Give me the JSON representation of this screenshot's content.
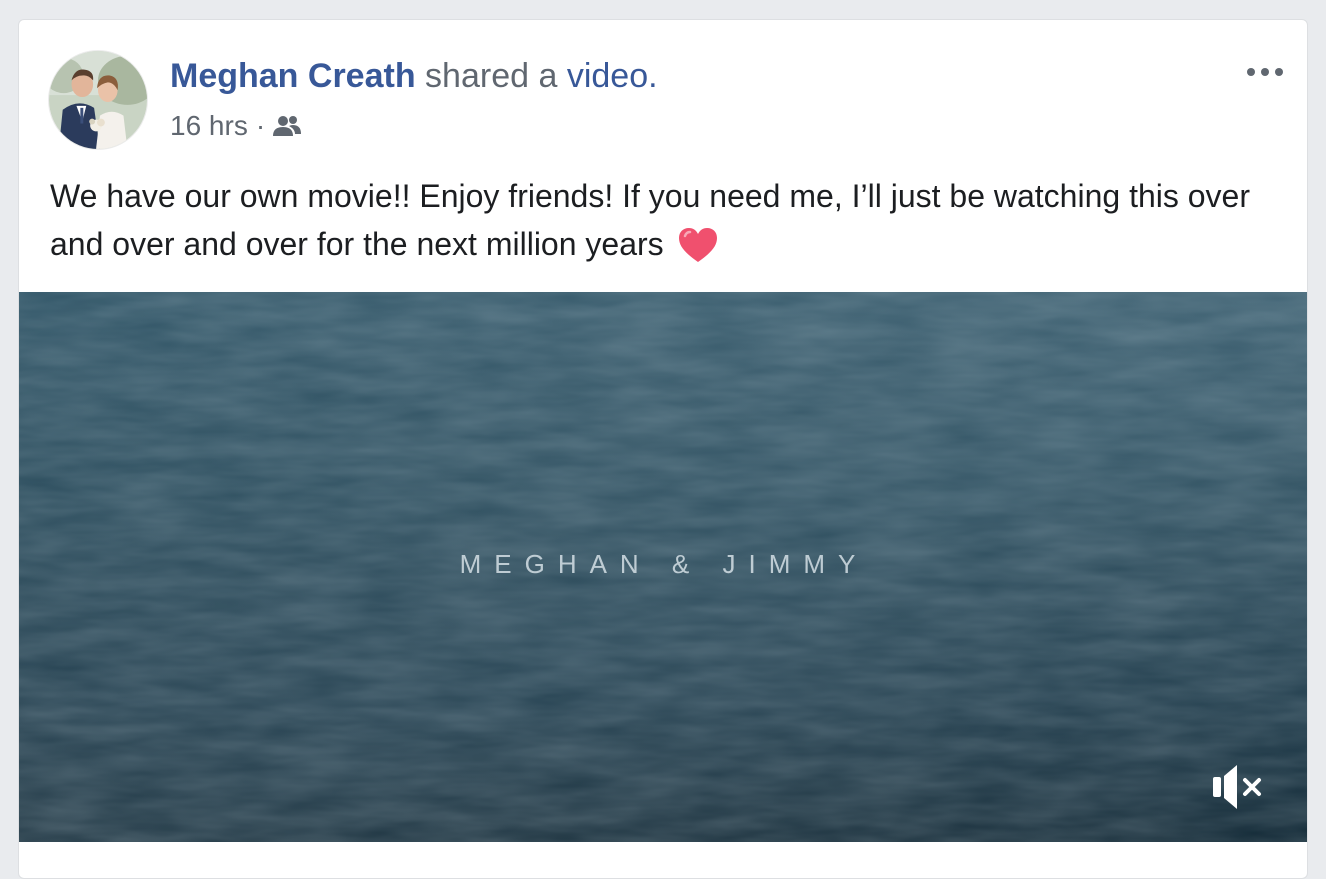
{
  "post": {
    "author": "Meghan Creath",
    "action_text": "shared a",
    "object_text": "video.",
    "timestamp": "16 hrs",
    "separator": "·",
    "audience_icon": "friends-icon",
    "more_icon": "more-options-icon",
    "body_text": "We have our own movie!! Enjoy friends! If you need me, I’ll just be watching this over and over and over for the next million years",
    "emoji": "heart-emoji"
  },
  "video": {
    "title_text": "MEGHAN & JIMMY",
    "mute_icon": "muted-speaker-icon"
  },
  "colors": {
    "link": "#385898",
    "secondary_text": "#606770",
    "primary_text": "#1c1e21",
    "page_background": "#e9ebee",
    "ocean": "#16323f",
    "heart": "#f0506e"
  }
}
